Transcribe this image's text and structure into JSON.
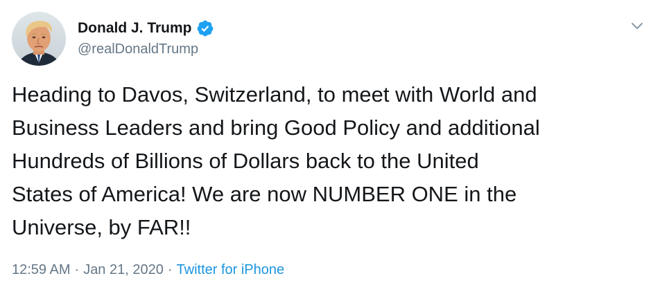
{
  "author": {
    "display_name": "Donald J. Trump",
    "handle": "@realDonaldTrump",
    "verified": true,
    "avatar_icon": "profile-photo",
    "verified_icon": "verified-badge-icon"
  },
  "menu": {
    "icon": "chevron-down-icon"
  },
  "tweet": {
    "text": "Heading to Davos, Switzerland, to meet with World and\nBusiness Leaders and bring Good Policy and additional\nHundreds of Billions of Dollars back to the United\nStates of America! We are now NUMBER ONE in the\nUniverse, by FAR!!",
    "time": "12:59 AM",
    "separator": "·",
    "date": "Jan 21, 2020",
    "source": "Twitter for iPhone"
  },
  "colors": {
    "link": "#1b95e0",
    "verified": "#1da1f2",
    "secondary_text": "#657786",
    "primary_text": "#14171a"
  }
}
